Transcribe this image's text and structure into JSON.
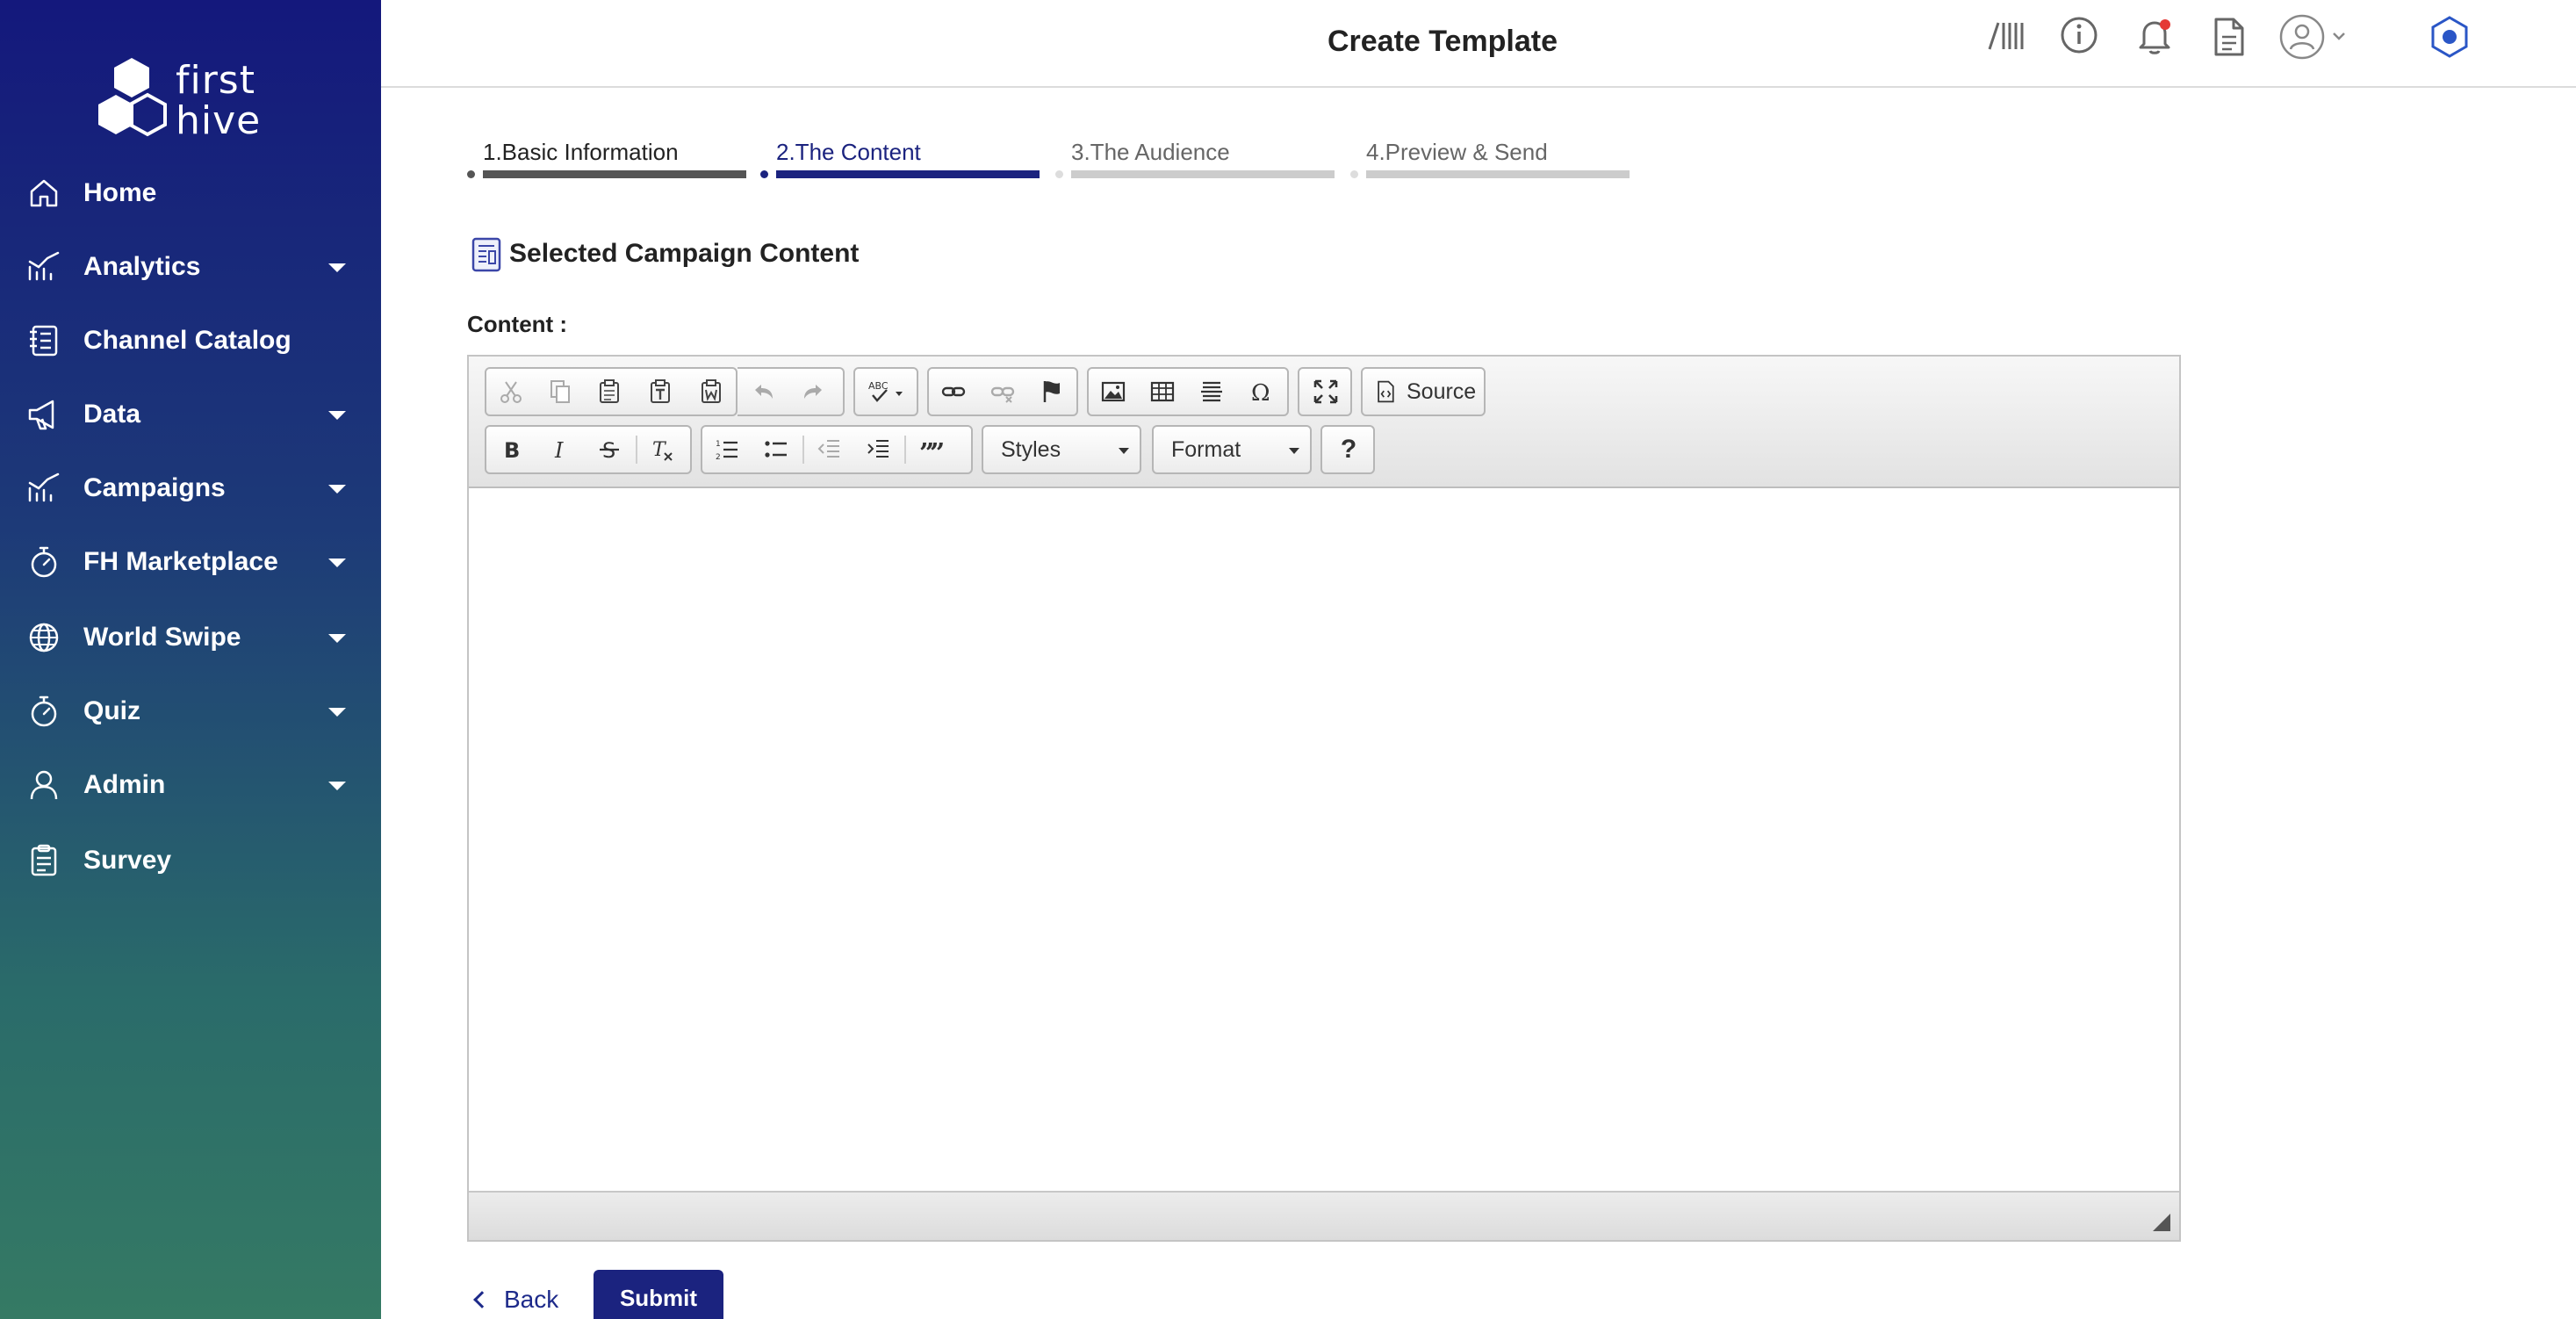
{
  "window": {
    "title": "Create Template"
  },
  "logo": {
    "line1": "first",
    "line2": "hive"
  },
  "sidebar": {
    "items": [
      {
        "label": "Home",
        "icon": "home-icon",
        "has_dropdown": false
      },
      {
        "label": "Analytics",
        "icon": "analytics-icon",
        "has_dropdown": true
      },
      {
        "label": "Channel Catalog",
        "icon": "catalog-icon",
        "has_dropdown": false
      },
      {
        "label": "Data",
        "icon": "megaphone-icon",
        "has_dropdown": true
      },
      {
        "label": "Campaigns",
        "icon": "campaigns-icon",
        "has_dropdown": true
      },
      {
        "label": "FH Marketplace",
        "icon": "stopwatch-icon",
        "has_dropdown": true
      },
      {
        "label": "World Swipe",
        "icon": "globe-icon",
        "has_dropdown": true
      },
      {
        "label": "Quiz",
        "icon": "stopwatch-icon",
        "has_dropdown": true
      },
      {
        "label": "Admin",
        "icon": "user-icon",
        "has_dropdown": true
      },
      {
        "label": "Survey",
        "icon": "clipboard-icon",
        "has_dropdown": false
      }
    ]
  },
  "header": {
    "icons": [
      "barcode-icon",
      "info-icon",
      "bell-icon",
      "document-icon",
      "user-avatar-icon",
      "settings-hex-icon"
    ],
    "notification_dot_color": "#e53935"
  },
  "stepper": {
    "steps": [
      {
        "label": "1.Basic Information",
        "state": "completed"
      },
      {
        "label": "2.The Content",
        "state": "active"
      },
      {
        "label": "3.The Audience",
        "state": "pending"
      },
      {
        "label": "4.Preview & Send",
        "state": "pending"
      }
    ],
    "colors": {
      "completed": "#555555",
      "active": "#1b237f",
      "pending": "#cccccc"
    }
  },
  "section": {
    "title": "Selected Campaign Content",
    "content_label": "Content :"
  },
  "editor": {
    "toolbar": {
      "source_label": "Source",
      "styles_label": "Styles",
      "format_label": "Format",
      "help_label": "?"
    },
    "body_text": ""
  },
  "actions": {
    "back_label": "Back",
    "submit_label": "Submit"
  },
  "colors": {
    "brand": "#1b237f",
    "sidebar_top": "#14187c",
    "sidebar_bottom": "#357a64"
  }
}
